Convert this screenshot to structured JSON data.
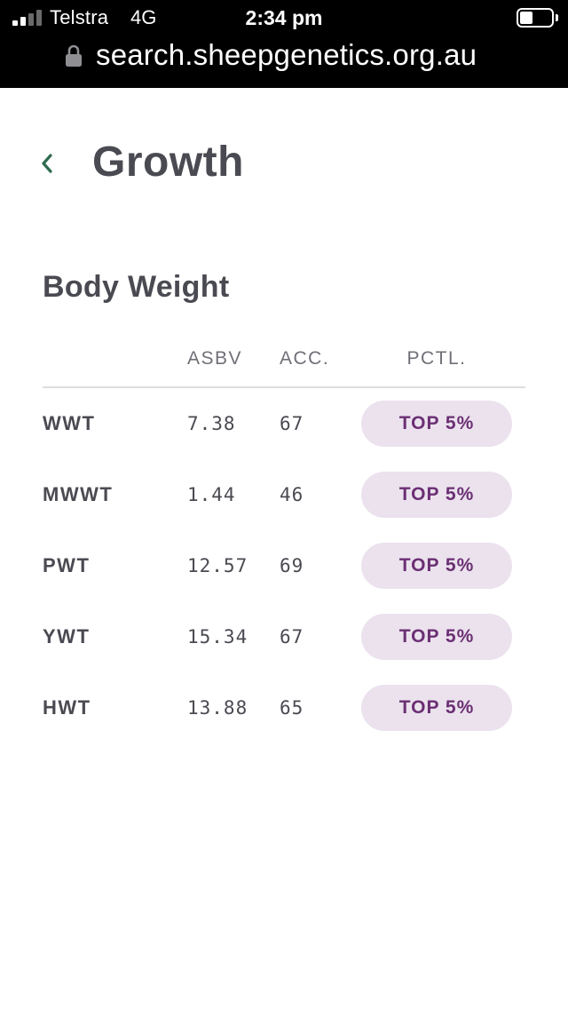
{
  "status_bar": {
    "carrier": "Telstra",
    "network": "4G",
    "time": "2:34 pm",
    "signal_bars_filled": 2,
    "signal_bars_total": 4,
    "battery_level": 0.4
  },
  "address_bar": {
    "url": "search.sheepgenetics.org.au",
    "lock_icon": "lock-icon"
  },
  "header": {
    "back_icon": "chevron-left-icon",
    "title": "Growth"
  },
  "section": {
    "title": "Body Weight",
    "columns": {
      "asbv": "ASBV",
      "acc": "ACC.",
      "pctl": "PCTL."
    },
    "rows": [
      {
        "trait": "WWT",
        "asbv": "7.38",
        "acc": "67",
        "pctl": "TOP 5%"
      },
      {
        "trait": "MWWT",
        "asbv": "1.44",
        "acc": "46",
        "pctl": "TOP 5%"
      },
      {
        "trait": "PWT",
        "asbv": "12.57",
        "acc": "69",
        "pctl": "TOP 5%"
      },
      {
        "trait": "YWT",
        "asbv": "15.34",
        "acc": "67",
        "pctl": "TOP 5%"
      },
      {
        "trait": "HWT",
        "asbv": "13.88",
        "acc": "65",
        "pctl": "TOP 5%"
      }
    ]
  },
  "colors": {
    "accent_green": "#2e6b4e",
    "pill_background": "#ebe2ee",
    "pill_text": "#6b2f73",
    "text_dark": "#4a4a52"
  }
}
